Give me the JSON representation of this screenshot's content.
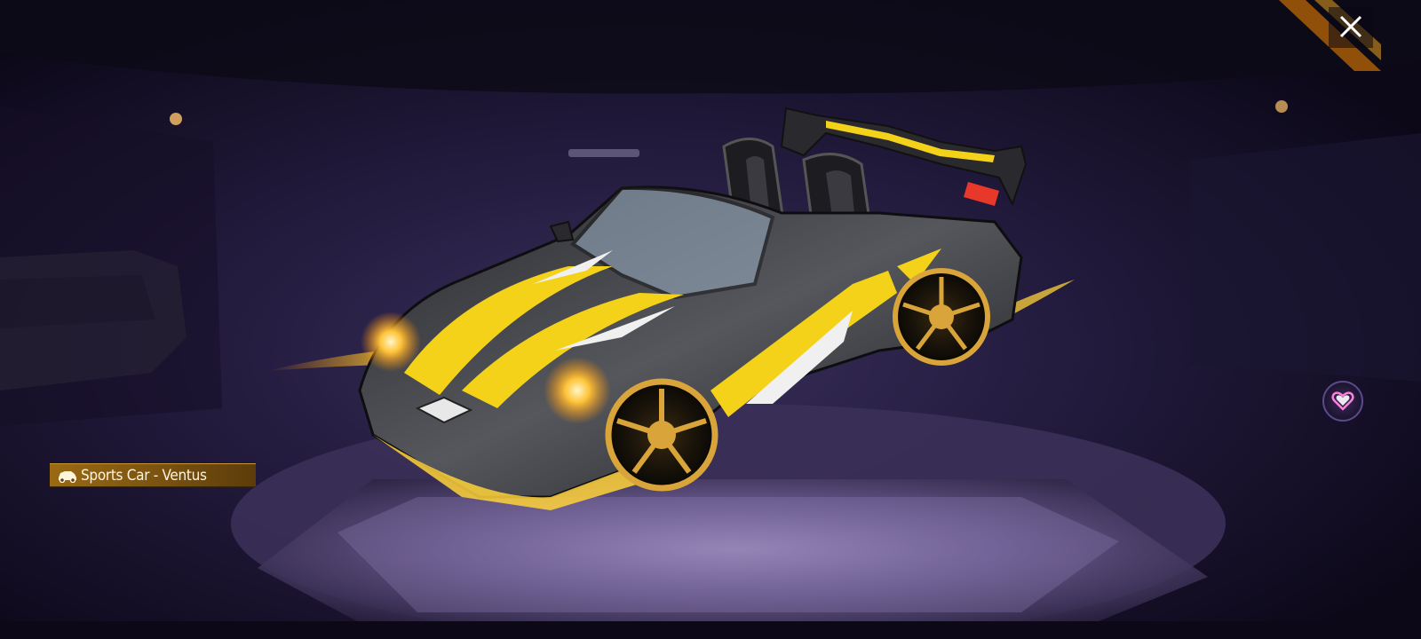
{
  "vehicle": {
    "type_icon": "car-icon",
    "name_label": "Sports Car - Ventus"
  },
  "controls": {
    "close_icon": "close-icon",
    "favorite_icon": "heart-icon"
  },
  "colors": {
    "background": "#120d22",
    "accent_gold": "#f5d21a",
    "tag_gold": "#9a6a12",
    "favorite_pink": "#ff7fd8"
  }
}
